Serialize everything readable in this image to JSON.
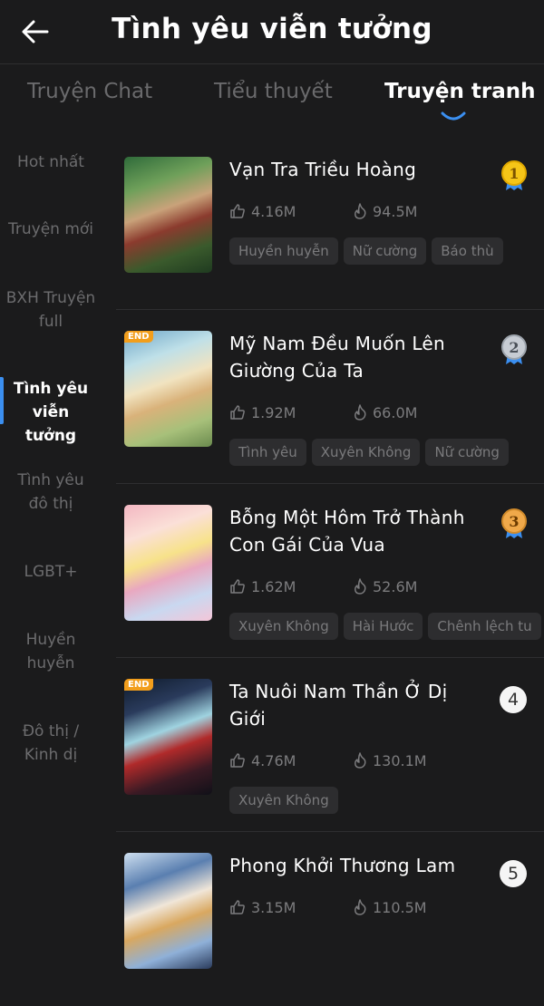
{
  "header": {
    "title": "Tình yêu viễn tưởng",
    "back_icon": "arrow-left-icon"
  },
  "tabs": [
    {
      "label": "Truyện Chat",
      "active": false
    },
    {
      "label": "Tiểu thuyết",
      "active": false
    },
    {
      "label": "Truyện tranh",
      "active": true
    }
  ],
  "sidebar": [
    {
      "label": "Hot nhất",
      "active": false
    },
    {
      "label": "Truyện mới",
      "active": false
    },
    {
      "label": "BXH Truyện full",
      "active": false
    },
    {
      "label": "Tình yêu viễn tưởng",
      "active": true
    },
    {
      "label": "Tình yêu đô thị",
      "active": false
    },
    {
      "label": "LGBT+",
      "active": false
    },
    {
      "label": "Huyền huyễn",
      "active": false
    },
    {
      "label": "Đô thị / Kinh dị",
      "active": false
    }
  ],
  "books": [
    {
      "rank": "1",
      "title": "Vạn Tra Triều Hoàng",
      "likes": "4.16M",
      "views": "94.5M",
      "tags": [
        "Huyền huyễn",
        "Nữ cường",
        "Báo thù"
      ],
      "end": false
    },
    {
      "rank": "2",
      "title": "Mỹ Nam Đều Muốn Lên Giường Của Ta",
      "likes": "1.92M",
      "views": "66.0M",
      "tags": [
        "Tình yêu",
        "Xuyên Không",
        "Nữ cường"
      ],
      "end": true
    },
    {
      "rank": "3",
      "title": "Bỗng Một Hôm Trở Thành Con Gái Của Vua",
      "likes": "1.62M",
      "views": "52.6M",
      "tags": [
        "Xuyên Không",
        "Hài Hước",
        "Chênh lệch tu"
      ],
      "end": false
    },
    {
      "rank": "4",
      "title": "Ta Nuôi Nam Thần Ở Dị Giới",
      "likes": "4.76M",
      "views": "130.1M",
      "tags": [
        "Xuyên Không"
      ],
      "end": true
    },
    {
      "rank": "5",
      "title": "Phong Khởi Thương Lam",
      "likes": "3.15M",
      "views": "110.5M",
      "tags": [],
      "end": false
    }
  ],
  "end_badge": "END",
  "colors": {
    "background": "#1b1b1c",
    "accent": "#3b8ff0",
    "gold": "#f5c518",
    "silver": "#c7ccd3",
    "bronze": "#f0a94a",
    "end_badge": "#f29e1c"
  },
  "icons": {
    "like": "thumbs-up-icon",
    "views": "flame-icon",
    "rank_medal": "medal-icon"
  }
}
